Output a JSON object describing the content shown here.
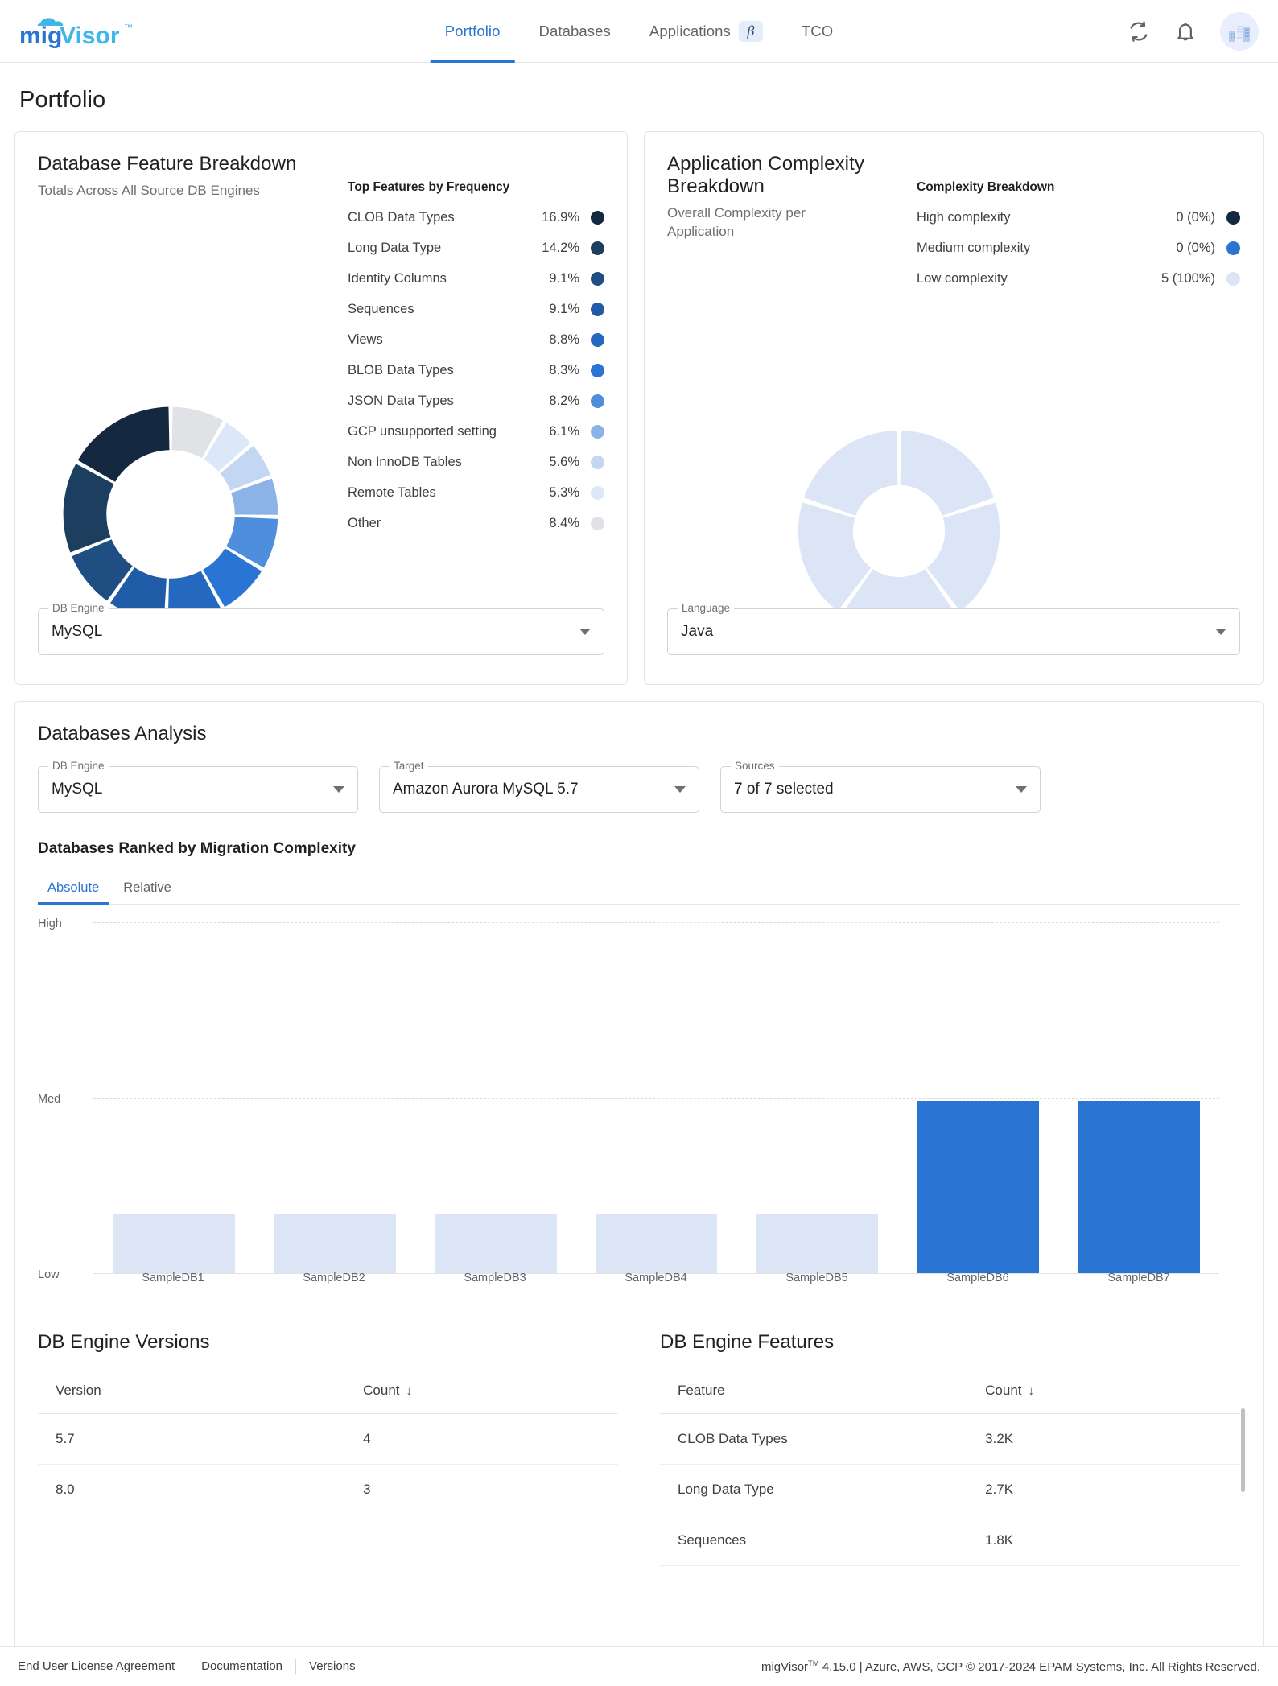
{
  "app": {
    "logo_text": "migVisor",
    "logo_tm": "™"
  },
  "nav": {
    "items": [
      {
        "label": "Portfolio",
        "active": true,
        "badge": ""
      },
      {
        "label": "Databases",
        "active": false,
        "badge": ""
      },
      {
        "label": "Applications",
        "active": false,
        "badge": "β"
      },
      {
        "label": "TCO",
        "active": false,
        "badge": ""
      }
    ],
    "icons": [
      "refresh-icon",
      "bell-icon",
      "company-avatar"
    ]
  },
  "page": {
    "title": "Portfolio"
  },
  "feature_card": {
    "title": "Database Feature Breakdown",
    "subtitle": "Totals Across All Source DB Engines",
    "legend_title": "Top Features by Frequency",
    "select": {
      "label": "DB Engine",
      "value": "MySQL"
    }
  },
  "complexity_card": {
    "title": "Application Complexity Breakdown",
    "subtitle": "Overall Complexity per Application",
    "legend_title": "Complexity Breakdown",
    "legend": [
      {
        "label": "High complexity",
        "value": "0 (0%)",
        "color": "#14293f"
      },
      {
        "label": "Medium complexity",
        "value": "0 (0%)",
        "color": "#2a74d4"
      },
      {
        "label": "Low complexity",
        "value": "5 (100%)",
        "color": "#dbe5f6"
      }
    ],
    "select": {
      "label": "Language",
      "value": "Java"
    }
  },
  "analysis": {
    "title": "Databases Analysis",
    "filters": [
      {
        "label": "DB Engine",
        "value": "MySQL"
      },
      {
        "label": "Target",
        "value": "Amazon Aurora MySQL 5.7"
      },
      {
        "label": "Sources",
        "value": "7 of 7 selected"
      }
    ],
    "section_title": "Databases Ranked by Migration Complexity",
    "tabs": [
      {
        "label": "Absolute",
        "active": true
      },
      {
        "label": "Relative",
        "active": false
      }
    ]
  },
  "versions_table": {
    "title": "DB Engine Versions",
    "columns": [
      "Version",
      "Count"
    ],
    "sort_icon": "↓",
    "rows": [
      {
        "version": "5.7",
        "count": "4"
      },
      {
        "version": "8.0",
        "count": "3"
      }
    ]
  },
  "features_table": {
    "title": "DB Engine Features",
    "columns": [
      "Feature",
      "Count"
    ],
    "sort_icon": "↓",
    "rows": [
      {
        "feature": "CLOB Data Types",
        "count": "3.2K"
      },
      {
        "feature": "Long Data Type",
        "count": "2.7K"
      },
      {
        "feature": "Sequences",
        "count": "1.8K"
      }
    ]
  },
  "footer": {
    "links": [
      "End User License Agreement",
      "Documentation",
      "Versions"
    ],
    "copyright_pre": "migVisor",
    "copyright_tm": "TM",
    "copyright_post": " 4.15.0 | Azure, AWS, GCP © 2017-2024 EPAM Systems, Inc. All Rights Reserved."
  },
  "colors": {
    "accent": "#2a74d4",
    "darkest": "#14293f",
    "grey": "#e0e2e5",
    "bar_low": "#dbe5f6",
    "bar_high": "#2a74d4"
  },
  "chart_data": [
    {
      "type": "pie",
      "title": "Database Feature Breakdown",
      "subtitle": "Totals Across All Source DB Engines",
      "legend_title": "Top Features by Frequency",
      "legend_position": "right",
      "labels": [
        "CLOB Data Types",
        "Long Data Type",
        "Identity Columns",
        "Sequences",
        "Views",
        "BLOB Data Types",
        "JSON Data Types",
        "GCP unsupported setting",
        "Non InnoDB Tables",
        "Remote Tables",
        "Other"
      ],
      "values": [
        16.9,
        14.2,
        9.1,
        9.1,
        8.8,
        8.3,
        8.2,
        6.1,
        5.6,
        5.3,
        8.4
      ],
      "value_labels": [
        "16.9%",
        "14.2%",
        "9.1%",
        "9.1%",
        "8.8%",
        "8.3%",
        "8.2%",
        "6.1%",
        "5.6%",
        "5.3%",
        "8.4%"
      ],
      "colors": [
        "#14293f",
        "#1c3f60",
        "#1f4e82",
        "#1f5ba6",
        "#2468bf",
        "#2a74d4",
        "#4f8ddd",
        "#8cb3e8",
        "#c3d6f2",
        "#dce7f8",
        "#e0e2e5"
      ]
    },
    {
      "type": "pie",
      "title": "Application Complexity Breakdown",
      "subtitle": "Overall Complexity per Application",
      "legend_title": "Complexity Breakdown",
      "legend_position": "right",
      "labels": [
        "High complexity",
        "Medium complexity",
        "Low complexity"
      ],
      "values": [
        0,
        0,
        5
      ],
      "value_labels": [
        "0 (0%)",
        "0 (0%)",
        "5 (100%)"
      ],
      "colors": [
        "#14293f",
        "#2a74d4",
        "#dbe5f6"
      ],
      "slices_drawn": 5
    },
    {
      "type": "bar",
      "title": "Databases Ranked by Migration Complexity",
      "categories": [
        "SampleDB1",
        "SampleDB2",
        "SampleDB3",
        "SampleDB4",
        "SampleDB5",
        "SampleDB6",
        "SampleDB7"
      ],
      "values": [
        0.17,
        0.17,
        0.17,
        0.17,
        0.17,
        0.49,
        0.49
      ],
      "bar_colors": [
        "#dbe5f6",
        "#dbe5f6",
        "#dbe5f6",
        "#dbe5f6",
        "#dbe5f6",
        "#2a74d4",
        "#2a74d4"
      ],
      "ytick_labels": [
        "High",
        "Med",
        "Low"
      ],
      "ytick_positions": [
        1.0,
        0.5,
        0.0
      ],
      "ylim": [
        0,
        1
      ],
      "xlabel": "",
      "ylabel": "",
      "grid": true
    }
  ]
}
